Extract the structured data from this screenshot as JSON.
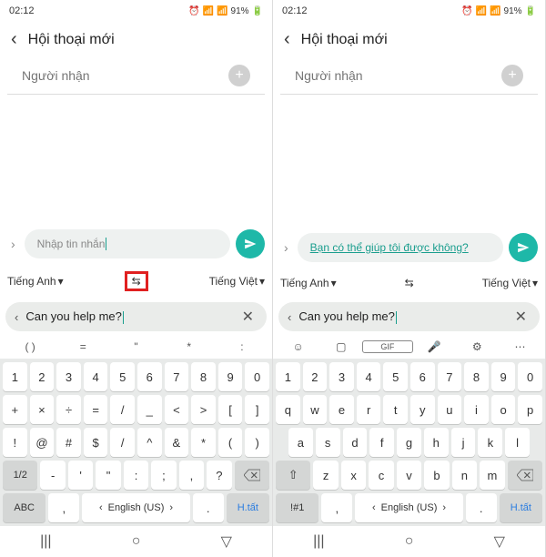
{
  "status": {
    "time": "02:12",
    "battery": "91%"
  },
  "header": {
    "title": "Hội thoại mới"
  },
  "recipient": {
    "placeholder": "Người nhận"
  },
  "messageInput": {
    "left_placeholder": "Nhập tin nhắn",
    "right_translated": "Bạn có thể giúp tôi được không?"
  },
  "langBar": {
    "from": "Tiếng Anh",
    "to": "Tiếng Việt"
  },
  "translateField": "Can you help me?",
  "toolbar_left": [
    "( )",
    "=",
    "\"",
    "*",
    ":"
  ],
  "kb_left": {
    "r1": [
      "1",
      "2",
      "3",
      "4",
      "5",
      "6",
      "7",
      "8",
      "9",
      "0"
    ],
    "r2": [
      "+",
      "×",
      "÷",
      "=",
      "/",
      "_",
      "<",
      ">",
      "[",
      "]"
    ],
    "r3": [
      "!",
      "@",
      "#",
      "$",
      "/",
      "^",
      "&",
      "*",
      "(",
      ")"
    ],
    "r4": [
      "1/2",
      "-",
      "'",
      "\"",
      ":",
      ";",
      ",",
      "?"
    ],
    "r5": {
      "abc": "ABC",
      "comma": ",",
      "space": "English (US)",
      "period": ".",
      "done": "H.tất"
    }
  },
  "kb_right": {
    "r1": [
      "1",
      "2",
      "3",
      "4",
      "5",
      "6",
      "7",
      "8",
      "9",
      "0"
    ],
    "r2": [
      "q",
      "w",
      "e",
      "r",
      "t",
      "y",
      "u",
      "i",
      "o",
      "p"
    ],
    "r3": [
      "a",
      "s",
      "d",
      "f",
      "g",
      "h",
      "j",
      "k",
      "l"
    ],
    "r4": [
      "z",
      "x",
      "c",
      "v",
      "b",
      "n",
      "m"
    ],
    "r5": {
      "sym": "!#1",
      "comma": ",",
      "space": "English (US)",
      "period": ".",
      "done": "H.tất"
    }
  }
}
